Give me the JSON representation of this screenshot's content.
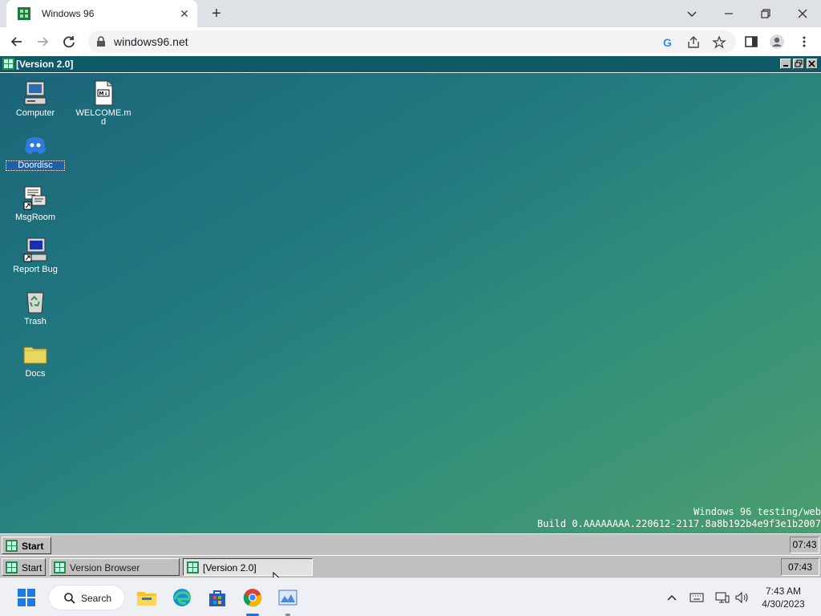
{
  "browser": {
    "tab_title": "Windows 96",
    "url": "windows96.net"
  },
  "w96": {
    "window_title": "[Version 2.0]",
    "desktop_icons": [
      {
        "label": "Computer"
      },
      {
        "label": "WELCOME.md"
      },
      {
        "label": "Doordisc"
      },
      {
        "label": "MsgRoom"
      },
      {
        "label": "Report Bug"
      },
      {
        "label": "Trash"
      },
      {
        "label": "Docs"
      }
    ],
    "welcome_badge": "M↓",
    "build_line1": "Windows 96 testing/web",
    "build_line2": "Build 0.AAAAAAAA.220612-2117.8a8b192b4e9f3e1b2007",
    "taskbar_top": {
      "start": "Start",
      "clock": "07:43"
    },
    "taskbar_bottom": {
      "start": "Start",
      "items": [
        "Version Browser",
        "[Version 2.0]"
      ],
      "clock": "07:43"
    }
  },
  "os_taskbar": {
    "search_label": "Search",
    "time": "7:43 AM",
    "date": "4/30/2023"
  },
  "colors": {
    "w96_titlebar": "#0f5a66",
    "w96_gray": "#c0c0c0",
    "desktop_start": "#1a6478",
    "desktop_end": "#4f9e6c"
  }
}
